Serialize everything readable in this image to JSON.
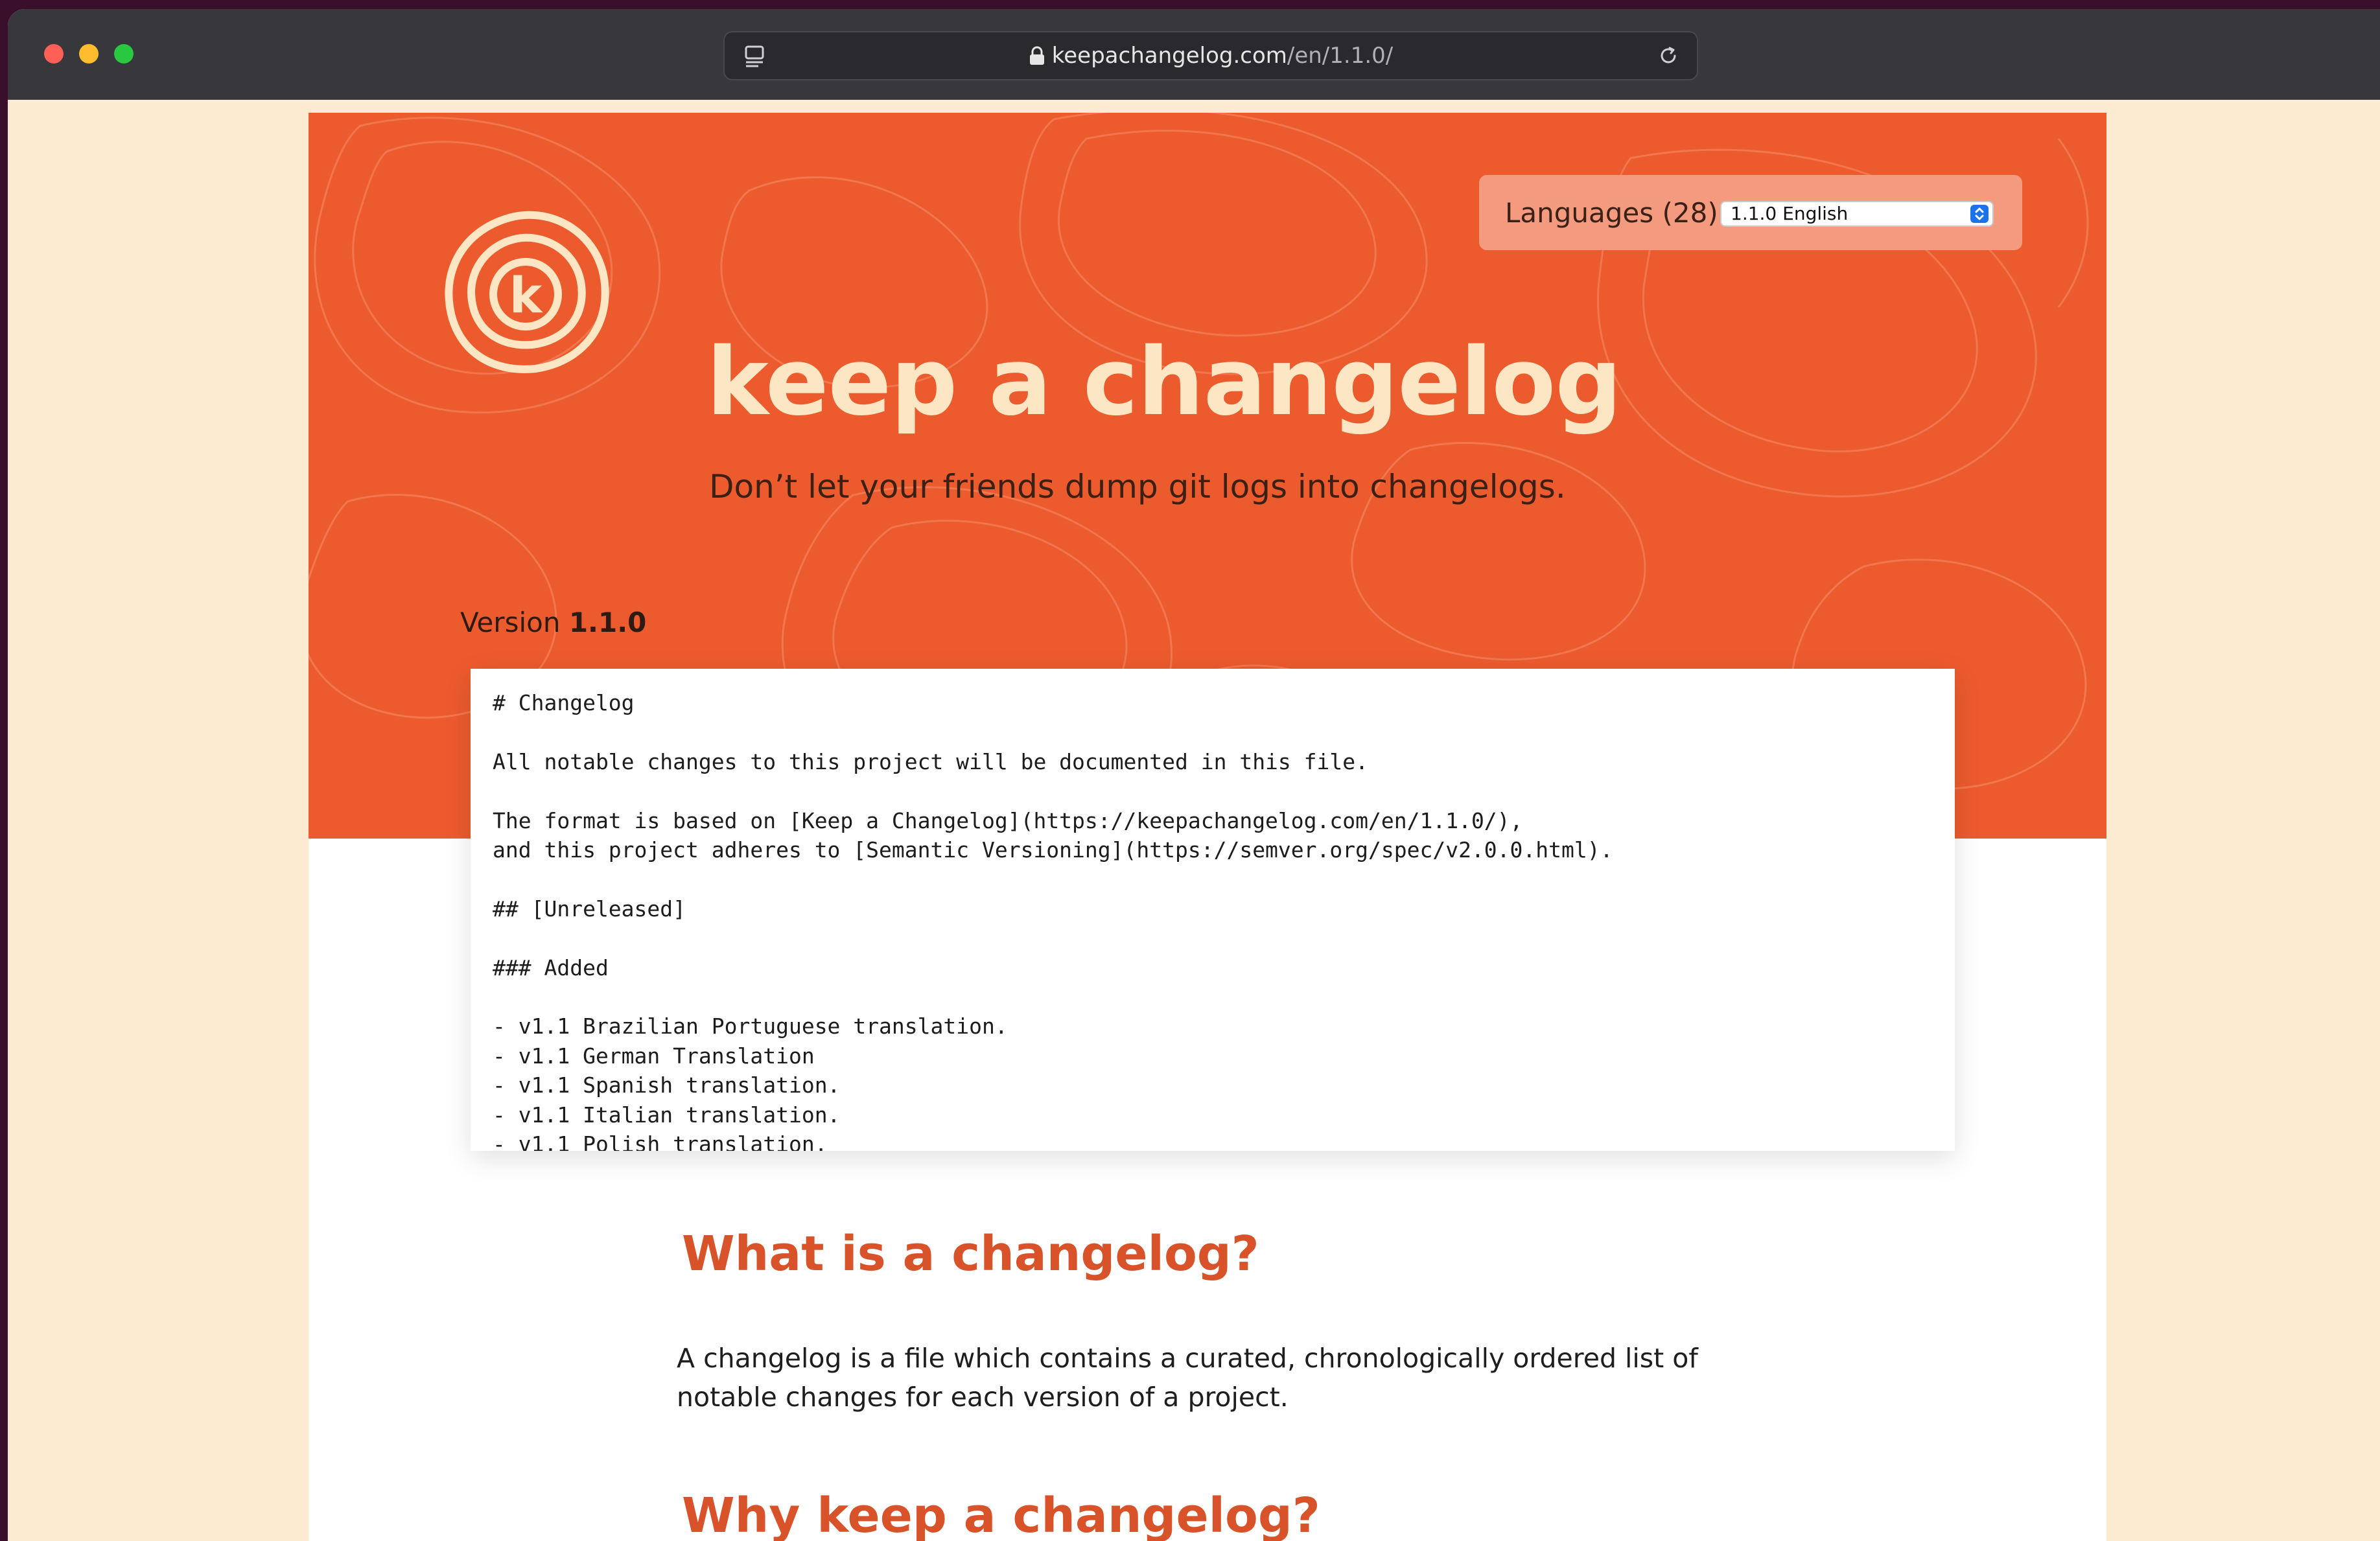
{
  "browser": {
    "url_host": "keepachangelog.com",
    "url_path": "/en/1.1.0/"
  },
  "header": {
    "title": "keep a changelog",
    "tagline": "Don’t let your friends dump git logs into changelogs.",
    "languages_label": "Languages (28):",
    "languages_selected": "1.1.0 English",
    "version_label": "Version",
    "version_number": "1.1.0"
  },
  "changelog_example": {
    "lines": [
      "# Changelog",
      "",
      "All notable changes to this project will be documented in this file.",
      "",
      "The format is based on [Keep a Changelog](https://keepachangelog.com/en/1.1.0/),",
      "and this project adheres to [Semantic Versioning](https://semver.org/spec/v2.0.0.html).",
      "",
      "## [Unreleased]",
      "",
      "### Added",
      "",
      "- v1.1 Brazilian Portuguese translation.",
      "- v1.1 German Translation",
      "- v1.1 Spanish translation.",
      "- v1.1 Italian translation.",
      "- v1.1 Polish translation."
    ]
  },
  "sections": {
    "what_heading": "What is a changelog?",
    "what_body": "A changelog is a file which contains a curated, chronologically ordered list of notable changes for each version of a project.",
    "why_heading": "Why keep a changelog?"
  },
  "colors": {
    "hero": "#ec5b2e",
    "cream": "#fde6c3",
    "heading": "#d9532a"
  },
  "icons": [
    "reader-icon",
    "lock-icon",
    "reload-icon",
    "logo-k-icon",
    "select-arrows-icon"
  ]
}
